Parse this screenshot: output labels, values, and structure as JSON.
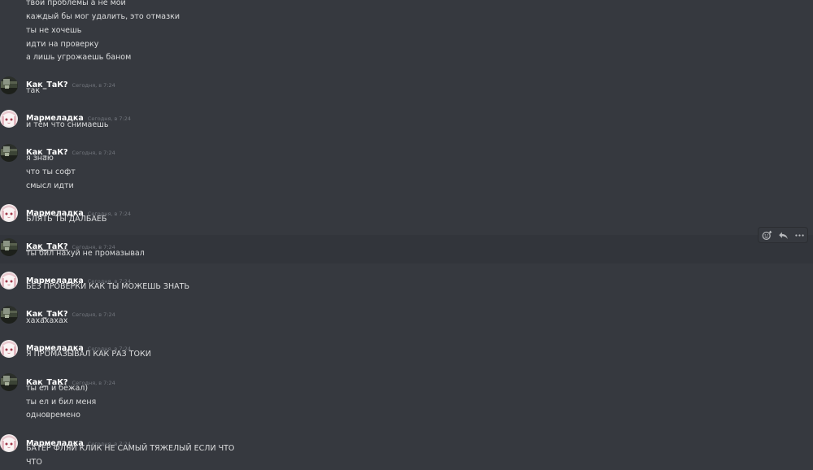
{
  "prev_lines": [
    "твои проблемы а не мои",
    "каждый бы мог удалить, это отмазки",
    "ты не хочешь",
    "идти на проверку",
    "а лишь угрожаешь баном"
  ],
  "users": {
    "kak": "Как_ТаК?",
    "marm": "Мармеладка"
  },
  "timestamp": "Сегодня, в 7:24",
  "groups": [
    {
      "author": "Как_ТаК?",
      "time": "Сегодня, в 7:24",
      "lines": [
        "так"
      ]
    },
    {
      "author": "Мармеладка",
      "time": "Сегодня, в 7:24",
      "lines": [
        "и тем что снимаешь"
      ]
    },
    {
      "author": "Как_ТаК?",
      "time": "Сегодня, в 7:24",
      "lines": [
        "я знаю",
        "что ты софт",
        "смысл идти"
      ]
    },
    {
      "author": "Мармеладка",
      "time": "Сегодня, в 7:24",
      "lines": [
        "БЛЯТЬ ТЫ ДАЛБАЕБ"
      ]
    },
    {
      "author": "Как_ТаК?",
      "time": "Сегодня, в 7:24",
      "lines": [
        "ты бил нахуй не промазывал"
      ]
    },
    {
      "author": "Мармеладка",
      "time": "Сегодня, в 7:24",
      "lines": [
        "БЕЗ ПРОВЕРКИ КАК ТЫ МОЖЕШЬ ЗНАТЬ"
      ]
    },
    {
      "author": "Как_ТаК?",
      "time": "Сегодня, в 7:24",
      "lines": [
        "хахахахах"
      ]
    },
    {
      "author": "Мармеладка",
      "time": "Сегодня, в 7:24",
      "lines": [
        "Я ПРОМАЗЫВАЛ КАК РАЗ ТОКИ"
      ]
    },
    {
      "author": "Как_ТаК?",
      "time": "Сегодня, в 7:24",
      "lines": [
        "ты ел и бежал)",
        "ты ел и бил меня",
        "одновремено"
      ]
    },
    {
      "author": "Мармеладка",
      "time": "Сегодня, в 7:24",
      "lines": [
        "БАТЕР ФЛЯЙ КЛИК НЕ САМЫЙ ТЯЖЕЛЫЙ ЕСЛИ ЧТО",
        "ЧТО"
      ]
    }
  ],
  "icons": {
    "add_reaction": "add-reaction-icon",
    "reply": "reply-icon",
    "more": "more-icon"
  },
  "colors": {
    "background": "#36393f",
    "hover_background": "#32353b",
    "text": "#dcddde",
    "username": "#ffffff",
    "timestamp": "#72767d"
  }
}
